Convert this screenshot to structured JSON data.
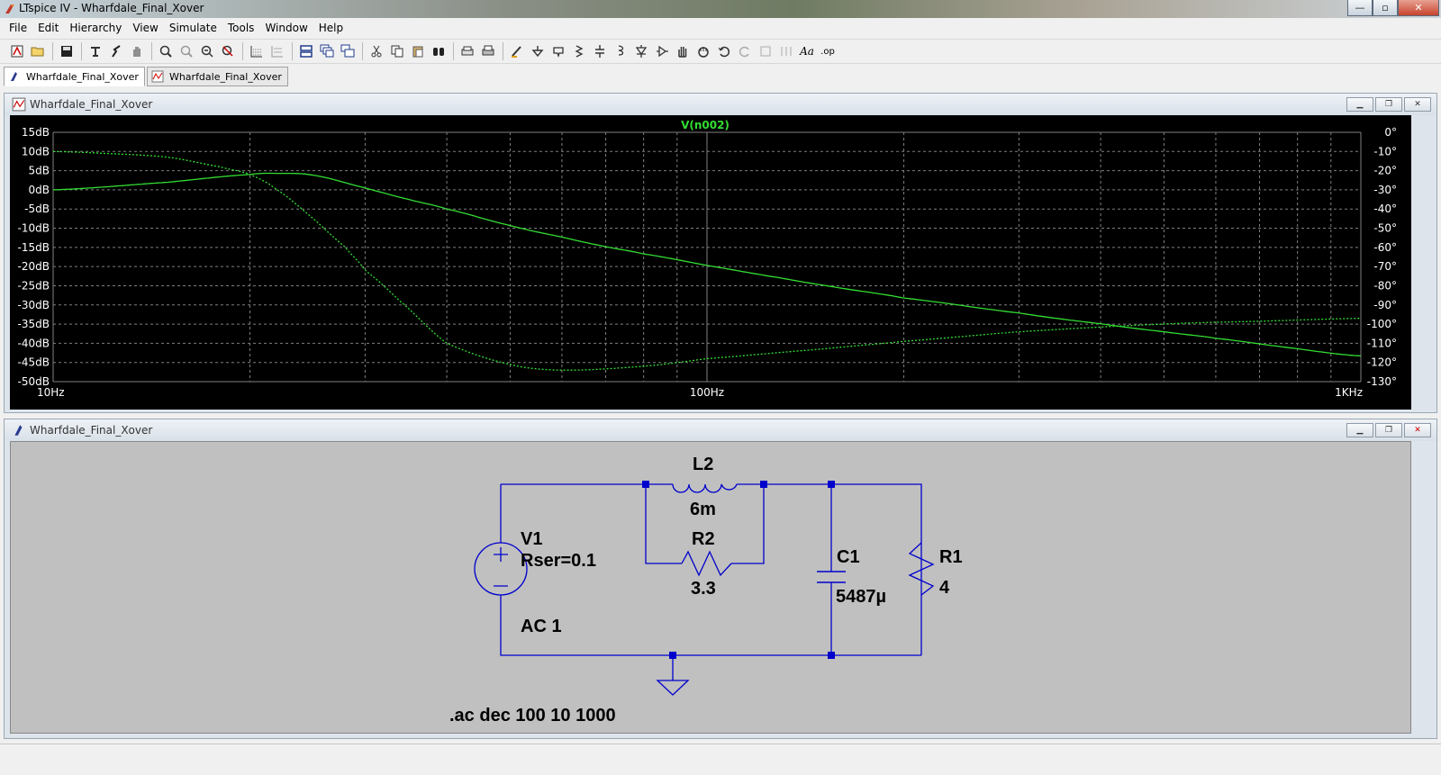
{
  "window": {
    "title": "LTspice IV - Wharfdale_Final_Xover",
    "min": "—",
    "max": "▫",
    "close": "✕"
  },
  "menu": [
    "File",
    "Edit",
    "Hierarchy",
    "View",
    "Simulate",
    "Tools",
    "Window",
    "Help"
  ],
  "toolbar": {
    "icons": [
      "new-schematic-icon",
      "open-icon",
      "save-icon",
      "control-panel-icon",
      "run-icon",
      "pan-hand-icon",
      "zoom-in-icon",
      "zoom-fit-icon",
      "zoom-out-icon",
      "zoom-cancel-icon",
      "autorange-icon",
      "grid-icon",
      "tile-horizontal-icon",
      "cascade-icon",
      "tile-vertical-icon",
      "cut-icon",
      "copy-icon",
      "paste-icon",
      "find-icon",
      "print-setup-icon",
      "print-icon",
      "wire-icon",
      "ground-icon",
      "label-net-icon",
      "resistor-icon",
      "capacitor-icon",
      "inductor-icon",
      "diode-icon",
      "component-icon",
      "move-icon",
      "drag-icon",
      "undo-icon",
      "redo-icon",
      "rotate-icon",
      "mirror-icon",
      "text-icon",
      "spice-directive-icon"
    ],
    "text_label": "Aa",
    "directive_label": ".op"
  },
  "tabs": [
    "Wharfdale_Final_Xover",
    "Wharfdale_Final_Xover"
  ],
  "waveform_window": {
    "title": "Wharfdale_Final_Xover"
  },
  "schematic_window": {
    "title": "Wharfdale_Final_Xover"
  },
  "plot": {
    "trace_label": "V(n002)",
    "trace_color": "#33dd33",
    "grid_color": "#7f7f7f",
    "background": "#000000",
    "left_ticks": [
      "15dB",
      "10dB",
      "5dB",
      "0dB",
      "-5dB",
      "-10dB",
      "-15dB",
      "-20dB",
      "-25dB",
      "-30dB",
      "-35dB",
      "-40dB",
      "-45dB",
      "-50dB"
    ],
    "right_ticks": [
      "0°",
      "-10°",
      "-20°",
      "-30°",
      "-40°",
      "-50°",
      "-60°",
      "-70°",
      "-80°",
      "-90°",
      "-100°",
      "-110°",
      "-120°",
      "-130°"
    ],
    "x_ticks": [
      "10Hz",
      "100Hz",
      "1KHz"
    ]
  },
  "chart_data": {
    "type": "line",
    "title": "V(n002)",
    "x_scale": "log",
    "xlim": [
      10,
      1000
    ],
    "ylim_left": [
      -50,
      15
    ],
    "ylim_right": [
      -130,
      0
    ],
    "grid": true,
    "series": [
      {
        "name": "V(n002)",
        "style": "solid",
        "axis": "left",
        "x": [
          10,
          15,
          20,
          22,
          25,
          30,
          35,
          40,
          50,
          60,
          70,
          80,
          100,
          130,
          160,
          200,
          300,
          400,
          500,
          600,
          800,
          1000
        ],
        "y": [
          0,
          2,
          4,
          4.3,
          3.8,
          0.5,
          -2.5,
          -5,
          -9.3,
          -12.3,
          -14.8,
          -16.7,
          -19.7,
          -23.0,
          -25.6,
          -28.2,
          -32.1,
          -34.9,
          -37.0,
          -38.7,
          -41.4,
          -43.3
        ]
      },
      {
        "name": "phase",
        "style": "dashed",
        "axis": "right",
        "x": [
          10,
          12,
          15,
          18,
          20,
          22,
          25,
          28,
          30,
          35,
          40,
          50,
          60,
          80,
          100,
          150,
          200,
          300,
          500,
          700,
          1000
        ],
        "y": [
          -10,
          -11,
          -13,
          -18,
          -22,
          -30,
          -45,
          -60,
          -72,
          -92,
          -110,
          -121,
          -124,
          -122,
          -118,
          -113,
          -109,
          -104,
          -100,
          -98.5,
          -97
        ]
      }
    ]
  },
  "schematic": {
    "v1_name": "V1",
    "v1_rser": "Rser=0.1",
    "v1_ac": "AC 1",
    "l2_name": "L2",
    "l2_value": "6m",
    "r2_name": "R2",
    "r2_value": "3.3",
    "c1_name": "C1",
    "c1_value": "5487µ",
    "r1_name": "R1",
    "r1_value": "4",
    "directive": ".ac dec 100 10 1000",
    "wire_color": "#0000cc"
  }
}
